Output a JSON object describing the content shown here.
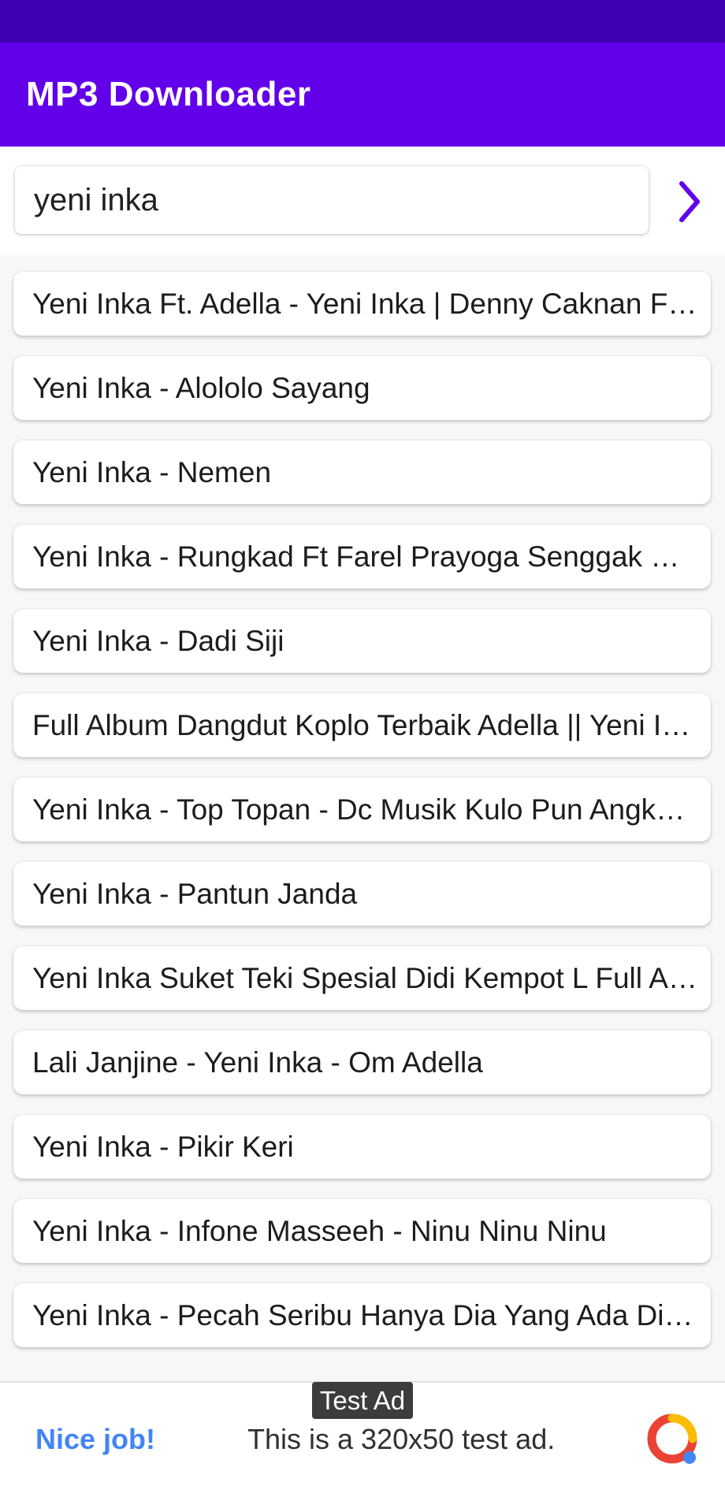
{
  "app_bar": {
    "title": "MP3 Downloader"
  },
  "search": {
    "value": "yeni inka",
    "submit_icon": "chevron-right-icon"
  },
  "results": [
    "Yeni Inka Ft. Adella - Yeni Inka | Denny Caknan Ft. Adella - Kartonyono Medot Janji",
    "Yeni Inka - Alololo Sayang",
    "Yeni Inka - Nemen",
    "Yeni Inka - Rungkad Ft Farel Prayoga Senggak Oa Oe",
    "Yeni Inka - Dadi Siji",
    "Full Album Dangdut Koplo Terbaik Adella || Yeni Inka",
    "Yeni Inka - Top Topan - Dc Musik Kulo Pun Angkat Tangan",
    "Yeni Inka - Pantun Janda",
    "Yeni Inka Suket Teki Spesial Didi Kempot L Full Album",
    "Lali Janjine - Yeni Inka - Om Adella",
    "Yeni Inka - Pikir Keri",
    "Yeni Inka - Infone Masseeh - Ninu Ninu Ninu",
    "Yeni Inka - Pecah Seribu Hanya Dia Yang Ada Dialam Mimpi"
  ],
  "ad": {
    "badge": "Test Ad",
    "headline": "Nice job!",
    "body": "This is a 320x50 test ad.",
    "logo_icon": "ad-network-logo-icon"
  },
  "colors": {
    "status_bar": "#3d00b0",
    "primary": "#6200ea",
    "accent": "#6200ea",
    "ad_link": "#4285f4"
  }
}
